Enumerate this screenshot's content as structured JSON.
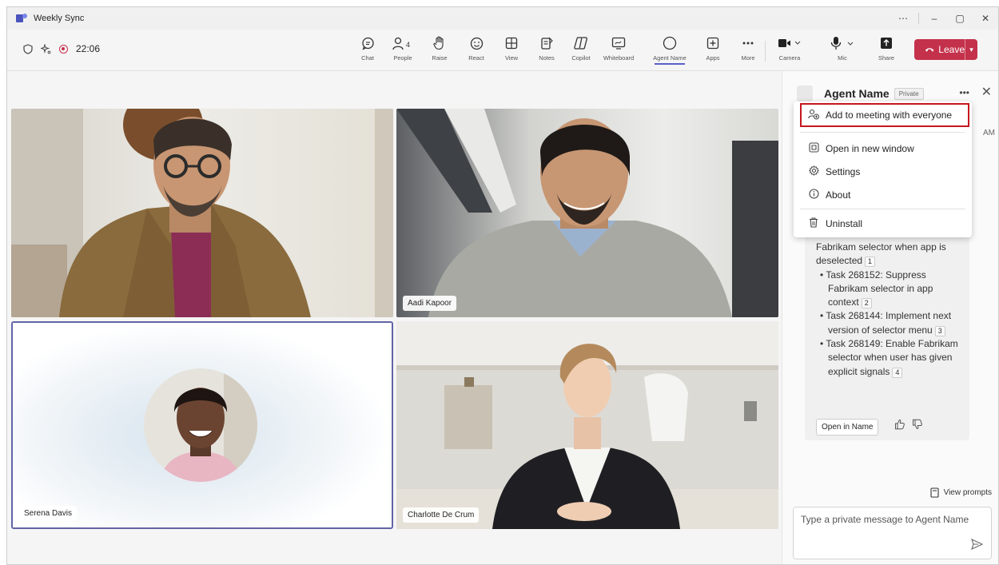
{
  "window": {
    "title": "Weekly Sync",
    "controls": [
      "⋯",
      "–",
      "▢",
      "✕"
    ]
  },
  "status": {
    "timer": "22:06"
  },
  "toolbar": [
    {
      "key": "chat",
      "label": "Chat",
      "icon": "chat-icon"
    },
    {
      "key": "people",
      "label": "People",
      "icon": "people-icon",
      "badge": "4"
    },
    {
      "key": "raise",
      "label": "Raise",
      "icon": "raise-hand-icon"
    },
    {
      "key": "react",
      "label": "React",
      "icon": "react-icon"
    },
    {
      "key": "view",
      "label": "View",
      "icon": "view-icon"
    },
    {
      "key": "notes",
      "label": "Notes",
      "icon": "notes-icon"
    },
    {
      "key": "copilot",
      "label": "Copilot",
      "icon": "copilot-icon"
    },
    {
      "key": "whiteboard",
      "label": "Whiteboard",
      "icon": "whiteboard-icon"
    },
    {
      "key": "agent",
      "label": "Agent Name",
      "icon": "agent-icon"
    },
    {
      "key": "apps",
      "label": "Apps",
      "icon": "apps-icon"
    },
    {
      "key": "more",
      "label": "More",
      "icon": "more-icon"
    },
    {
      "key": "camera",
      "label": "Camera",
      "icon": "camera-icon"
    },
    {
      "key": "mic",
      "label": "Mic",
      "icon": "mic-icon"
    },
    {
      "key": "share",
      "label": "Share",
      "icon": "share-icon"
    }
  ],
  "leave": {
    "label": "Leave",
    "color": "#c4314b"
  },
  "participants": [
    {
      "name": "",
      "key": "p1"
    },
    {
      "name": "Aadi Kapoor",
      "key": "p2"
    },
    {
      "name": "Serena Davis",
      "key": "p3"
    },
    {
      "name": "Charlotte De Crum",
      "key": "p4"
    }
  ],
  "panel": {
    "agent_name": "Agent Name",
    "badge": "Private",
    "time_fragment": "AM",
    "messages": [
      {
        "text": "Fabrikam selector when app is deselected",
        "cite": "1",
        "bullet": false
      },
      {
        "text": "Task 268152: Suppress Fabrikam selector in app context",
        "cite": "2",
        "bullet": true
      },
      {
        "text": "Task 268144: Implement next version of selector menu",
        "cite": "3",
        "bullet": true
      },
      {
        "text": "Task 268149: Enable Fabrikam selector when user has given explicit signals",
        "cite": "4",
        "bullet": true
      }
    ],
    "open_in": "Open in Name",
    "view_prompts": "View prompts",
    "compose_placeholder": "Type a private message to Agent Name"
  },
  "menu": {
    "items": [
      {
        "label": "Add to meeting with everyone",
        "icon": "add-to-meeting-icon",
        "highlighted": true
      },
      {
        "label": "Open in new window",
        "icon": "open-window-icon"
      },
      {
        "label": "Settings",
        "icon": "settings-icon"
      },
      {
        "label": "About",
        "icon": "info-icon"
      },
      {
        "label": "Uninstall",
        "icon": "trash-icon"
      }
    ]
  },
  "colors": {
    "accent": "#5b5fc7",
    "leave": "#c4314b",
    "highlight_border": "#c4171f"
  }
}
